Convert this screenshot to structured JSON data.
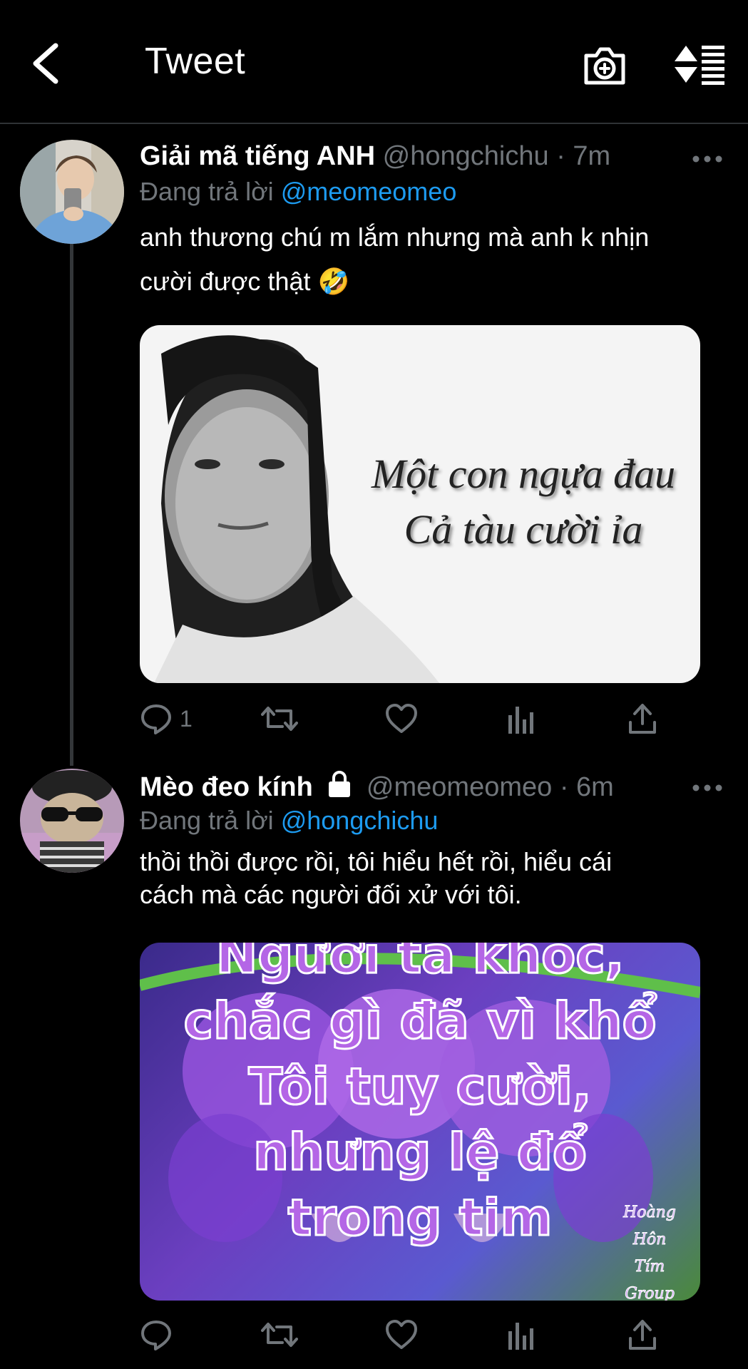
{
  "header": {
    "title": "Tweet",
    "icons": [
      "back-chevron-icon",
      "camera-plus-icon",
      "sort-list-icon"
    ]
  },
  "tweets": [
    {
      "name": "Giải mã tiếng ANH",
      "handle": "@hongchichu",
      "dot": "·",
      "time": "7m",
      "reply_prefix": "Đang trả lời",
      "reply_to": "@meomeomeo",
      "text_line1": "anh thương chú m lắm nhưng mà anh k nhịn",
      "text_line2": "cười được thật 🤣",
      "media_caption_line1": "Một con ngựa đau",
      "media_caption_line2": "Cả tàu cười ỉa",
      "reply_count": "1"
    },
    {
      "name": "Mèo đeo kính",
      "locked": true,
      "handle": "@meomeomeo",
      "dot": "·",
      "time": "6m",
      "reply_prefix": "Đang trả lời",
      "reply_to": "@hongchichu",
      "text_line1": "thồi thồi được rồi, tôi hiểu hết rồi, hiểu cái",
      "text_line2": "cách mà các người đối xử với tôi.",
      "media_lines": [
        "Người ta khóc,",
        "chắc gì đã vì khổ",
        "Tôi tuy cười,",
        "nhưng lệ đổ",
        "trong tim"
      ],
      "media_signature": [
        "Hoàng",
        "Hôn",
        "Tím",
        "Group"
      ],
      "reply_count": ""
    }
  ],
  "colors": {
    "link": "#1d9bf0",
    "muted": "#71767b",
    "divider": "#2f3336",
    "background": "#000000"
  }
}
